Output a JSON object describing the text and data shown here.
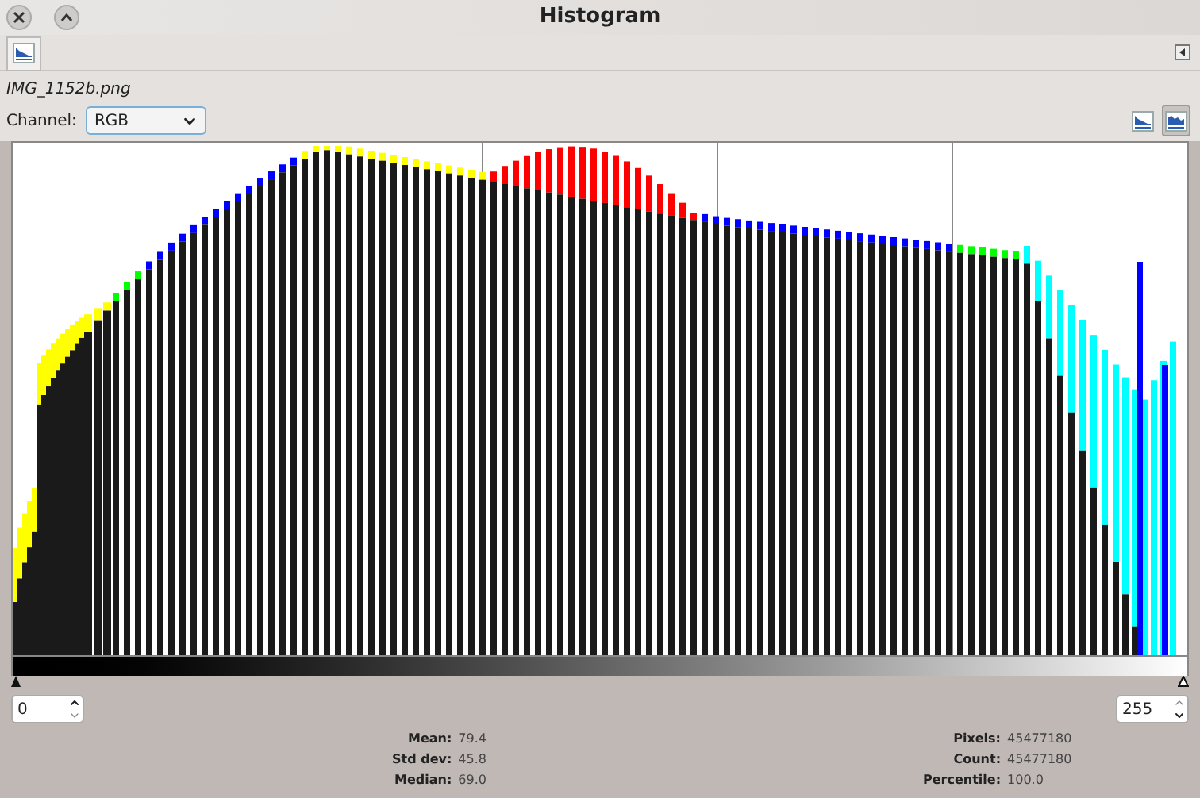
{
  "window": {
    "title": "Histogram"
  },
  "image_name": "IMG_1152b.png",
  "channel": {
    "label": "Channel:",
    "value": "RGB"
  },
  "scale_buttons": [
    {
      "kind": "linear",
      "selected": false
    },
    {
      "kind": "log",
      "selected": true
    }
  ],
  "range": {
    "low": "0",
    "high": "255"
  },
  "stats_left": [
    {
      "label": "Mean:",
      "value": "79.4"
    },
    {
      "label": "Std dev:",
      "value": "45.8"
    },
    {
      "label": "Median:",
      "value": "69.0"
    }
  ],
  "stats_right": [
    {
      "label": "Pixels:",
      "value": "45477180"
    },
    {
      "label": "Count:",
      "value": "45477180"
    },
    {
      "label": "Percentile:",
      "value": "100.0"
    }
  ]
}
